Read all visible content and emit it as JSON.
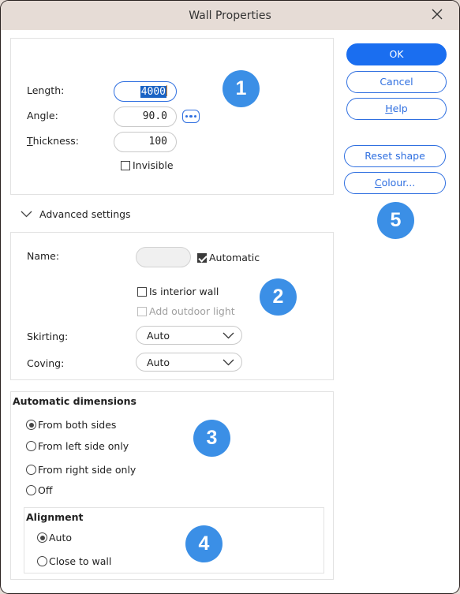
{
  "window": {
    "title": "Wall Properties"
  },
  "general": {
    "length_label": "Length:",
    "length_value": "4000",
    "angle_label": "Angle:",
    "angle_value": "90.0",
    "thickness_label_first": "T",
    "thickness_label_rest": "hickness:",
    "thickness_value": "100",
    "invisible_label": "Invisible",
    "invisible_checked": false
  },
  "advanced": {
    "toggle_label": "Advanced settings",
    "name_label": "Name:",
    "name_value": "",
    "automatic_label": "Automatic",
    "automatic_checked": true,
    "interior_label": "Is interior wall",
    "interior_checked": false,
    "outdoor_label": "Add outdoor light",
    "outdoor_checked": false,
    "outdoor_enabled": false,
    "skirting_label": "Skirting:",
    "skirting_value": "Auto",
    "coving_label": "Coving:",
    "coving_value": "Auto"
  },
  "auto_dimensions": {
    "heading": "Automatic dimensions",
    "options": [
      {
        "label": "From both sides",
        "selected": true
      },
      {
        "label": "From left side only",
        "selected": false
      },
      {
        "label": "From right side only",
        "selected": false
      },
      {
        "label": "Off",
        "selected": false
      }
    ]
  },
  "alignment": {
    "heading": "Alignment",
    "options": [
      {
        "label": "Auto",
        "selected": true
      },
      {
        "label": "Close to wall",
        "selected": false
      }
    ]
  },
  "buttons": {
    "ok": "OK",
    "cancel": "Cancel",
    "help_first": "H",
    "help_rest": "elp",
    "reset_shape": "Reset shape",
    "colour_first": "C",
    "colour_rest": "olour..."
  },
  "badges": [
    "1",
    "2",
    "3",
    "4",
    "5"
  ],
  "colors": {
    "accent": "#1a6ef0",
    "badge": "#3b8fe6",
    "titlebar": "#e6dcd6"
  }
}
